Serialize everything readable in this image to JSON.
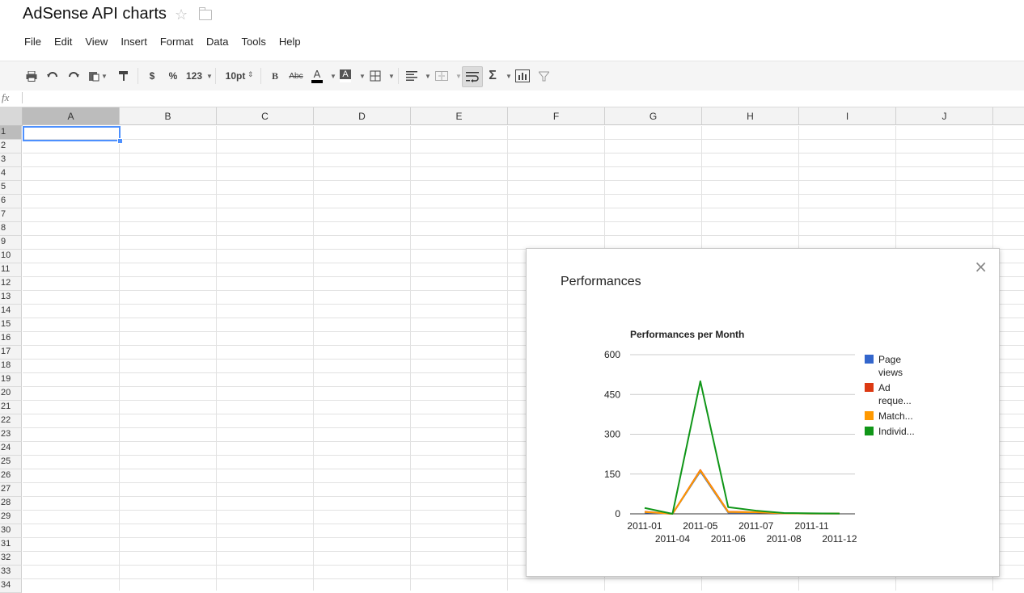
{
  "app": {
    "title": "AdSense API charts",
    "star_icon": "star-icon",
    "folder_icon": "folder-icon"
  },
  "menu": [
    "File",
    "Edit",
    "View",
    "Insert",
    "Format",
    "Data",
    "Tools",
    "Help"
  ],
  "toolbar": {
    "currency_label": "$",
    "percent_label": "%",
    "number_format_label": "123",
    "font_size_label": "10pt",
    "bold_label": "B",
    "strikethrough_label": "Abc",
    "text_color_label": "A",
    "highlight_color_label": "A",
    "sum_label": "Σ",
    "text_color": "#000000",
    "highlight_color": "#ffffff",
    "icons": [
      "print-icon",
      "undo-icon",
      "redo-icon",
      "paste-icon",
      "paint-format-icon",
      "borders-icon",
      "align-icon",
      "merge-icon",
      "wrap-text-icon",
      "functions-icon",
      "insert-chart-icon",
      "filter-icon"
    ]
  },
  "formula_bar": {
    "fx_label": "fx",
    "value": ""
  },
  "sheet": {
    "columns": [
      "A",
      "B",
      "C",
      "D",
      "E",
      "F",
      "G",
      "H",
      "I",
      "J"
    ],
    "rows": [
      "1",
      "2",
      "3",
      "4",
      "5",
      "6",
      "7",
      "8",
      "9",
      "10",
      "11",
      "12",
      "13",
      "14",
      "15",
      "16",
      "17",
      "18",
      "19",
      "20",
      "21",
      "22",
      "23",
      "24",
      "25",
      "26",
      "27",
      "28",
      "29",
      "30",
      "31",
      "32",
      "33",
      "34"
    ],
    "selected_cell": "A1"
  },
  "chart_panel": {
    "title": "Performances",
    "close_label": "×"
  },
  "chart_data": {
    "type": "line",
    "title": "Performances per Month",
    "xlabel": "",
    "ylabel": "",
    "x": [
      "2011-01",
      "2011-04",
      "2011-05",
      "2011-06",
      "2011-07",
      "2011-08",
      "2011-11",
      "2011-12"
    ],
    "ylim": [
      0,
      600
    ],
    "yticks": [
      0,
      150,
      300,
      450,
      600
    ],
    "grid": true,
    "legend_position": "right",
    "series": [
      {
        "name": "Page views",
        "legend_lines": [
          "Page",
          "views"
        ],
        "color": "#3366cc",
        "values": [
          5,
          0,
          160,
          5,
          5,
          2,
          1,
          1
        ]
      },
      {
        "name": "Ad reque...",
        "legend_lines": [
          "Ad",
          "reque..."
        ],
        "color": "#dc3912",
        "values": [
          8,
          0,
          165,
          8,
          6,
          2,
          1,
          1
        ]
      },
      {
        "name": "Match...",
        "legend_lines": [
          "Match..."
        ],
        "color": "#ff9900",
        "values": [
          7,
          0,
          163,
          7,
          6,
          2,
          1,
          1
        ]
      },
      {
        "name": "Individ...",
        "legend_lines": [
          "Individ..."
        ],
        "color": "#109618",
        "values": [
          22,
          0,
          500,
          25,
          12,
          3,
          2,
          1
        ]
      }
    ]
  }
}
